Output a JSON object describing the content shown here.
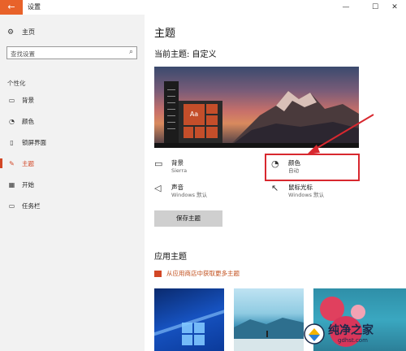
{
  "window": {
    "title": "设置",
    "back_glyph": "←",
    "minimize_glyph": "—",
    "maximize_glyph": "☐",
    "close_glyph": "✕"
  },
  "sidebar": {
    "home_label": "主页",
    "search_placeholder": "查找设置",
    "section_label": "个性化",
    "items": [
      {
        "label": "背景",
        "icon": "picture-icon"
      },
      {
        "label": "颜色",
        "icon": "palette-icon"
      },
      {
        "label": "锁屏界面",
        "icon": "lock-screen-icon"
      },
      {
        "label": "主题",
        "icon": "brush-icon",
        "active": true
      },
      {
        "label": "开始",
        "icon": "start-icon"
      },
      {
        "label": "任务栏",
        "icon": "taskbar-icon"
      }
    ]
  },
  "main": {
    "title": "主题",
    "current_theme": "当前主题: 自定义",
    "preview_tile_text": "Aa",
    "attributes": {
      "background": {
        "name": "背景",
        "value": "Sierra",
        "icon": "picture-icon"
      },
      "color": {
        "name": "颜色",
        "value": "自动",
        "icon": "palette-icon"
      },
      "sound": {
        "name": "声音",
        "value": "Windows 默认",
        "icon": "speaker-icon"
      },
      "cursor": {
        "name": "鼠标光标",
        "value": "Windows 默认",
        "icon": "cursor-icon"
      }
    },
    "save_button": "保存主题",
    "apply_title": "应用主题",
    "store_link": "从应用商店中获取更多主题"
  },
  "colors": {
    "accent": "#d24726",
    "highlight": "#d8282f",
    "titlebar_back": "#e8622a"
  },
  "watermark": {
    "text": "纯净之家",
    "url": "gdhst.com"
  }
}
